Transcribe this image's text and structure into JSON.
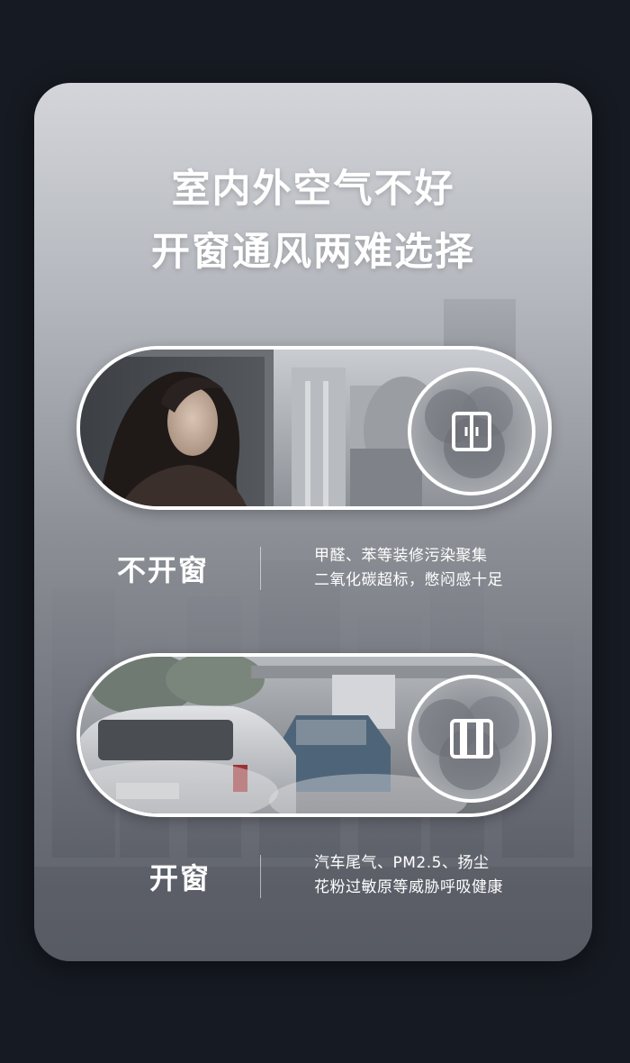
{
  "headline": {
    "line1": "室内外空气不好",
    "line2": "开窗通风两难选择"
  },
  "options": [
    {
      "label": "不开窗",
      "desc_line1": "甲醛、苯等装修污染聚集",
      "desc_line2": "二氧化碳超标，憋闷感十足",
      "icon": "closed-window-icon"
    },
    {
      "label": "开窗",
      "desc_line1": "汽车尾气、PM2.5、扬尘",
      "desc_line2": "花粉过敏原等威胁呼吸健康",
      "icon": "open-window-icon"
    }
  ],
  "colors": {
    "background": "#161a22",
    "card_top": "#d3d5da",
    "card_bottom": "#5b5f68",
    "text": "#ffffff"
  }
}
